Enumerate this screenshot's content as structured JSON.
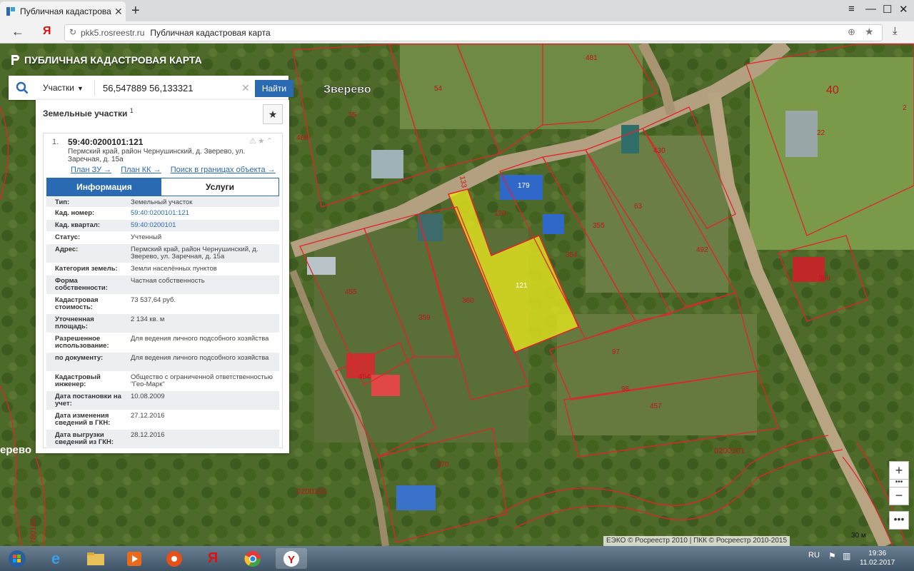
{
  "browser": {
    "tab_title": "Публичная кадастровая",
    "address_host": "pkk5.rosreestr.ru",
    "address_title": "Публичная кадастровая карта"
  },
  "app": {
    "title": "ПУБЛИЧНАЯ КАДАСТРОВАЯ КАРТА"
  },
  "search": {
    "type_label": "Участки",
    "query": "56,547889 56,133321",
    "button_label": "Найти"
  },
  "results": {
    "header": "Земельные участки",
    "count": "1",
    "item_index": "1.",
    "cad_number": "59:40:0200101:121",
    "address": "Пермский край, район Чернушинский, д. Зверево, ул. Заречная, д. 15а",
    "links": [
      "План ЗУ →",
      "План КК →",
      "Поиск в границах объекта →"
    ],
    "tabs": [
      "Информация",
      "Услуги"
    ],
    "fields": [
      {
        "k": "Тип:",
        "v": "Земельный участок"
      },
      {
        "k": "Кад. номер:",
        "v": "59:40:0200101:121"
      },
      {
        "k": "Кад. квартал:",
        "v": "59:40:0200101"
      },
      {
        "k": "Статус:",
        "v": "Учтенный"
      },
      {
        "k": "Адрес:",
        "v": "Пермский край, район Чернушинский, д. Зверево, ул. Заречная, д. 15а"
      },
      {
        "k": "Категория земель:",
        "v": "Земли населённых пунктов"
      },
      {
        "k": "Форма собственности:",
        "v": "Частная собственность"
      },
      {
        "k": "Кадастровая стоимость:",
        "v": "73 537,64 руб."
      },
      {
        "k": "Уточненная площадь:",
        "v": "2 134 кв. м"
      },
      {
        "k": "Разрешенное использование:",
        "v": "Для ведения личного подсобного хозяйства"
      },
      {
        "k": "по документу:",
        "v": "Для ведения личного подсобного хозяйства"
      },
      {
        "k": "Кадастровый инженер:",
        "v": "Общество с ограниченной ответственностью \"Гео-Марк\""
      },
      {
        "k": "Дата постановки на учет:",
        "v": "10.08.2009"
      },
      {
        "k": "Дата изменения сведений в ГКН:",
        "v": "27.12.2016"
      },
      {
        "k": "Дата выгрузки сведений из ГКН:",
        "v": "28.12.2016"
      }
    ]
  },
  "map": {
    "village_label": "Зверево",
    "edge_label": "ерево",
    "quarter_label": "0200101",
    "edge_quarter": "780101",
    "big_number": "40",
    "parcel_labels": [
      "481",
      "54",
      "55",
      "488",
      "133",
      "120",
      "121",
      "430",
      "63",
      "355",
      "354",
      "492",
      "22",
      "2",
      "368",
      "455",
      "360",
      "359",
      "454",
      "97",
      "98",
      "457",
      "370",
      "179"
    ],
    "attribution": "ЕЭКО © Росреестр 2010 | ПКК © Росреестр 2010-2015",
    "scale": "30 м",
    "colors": {
      "boundary": "#e0242c",
      "selected_fill": "#e6e61e",
      "label": "#c0151d"
    }
  },
  "taskbar": {
    "lang": "RU",
    "time": "19:36",
    "date": "11.02.2017"
  }
}
